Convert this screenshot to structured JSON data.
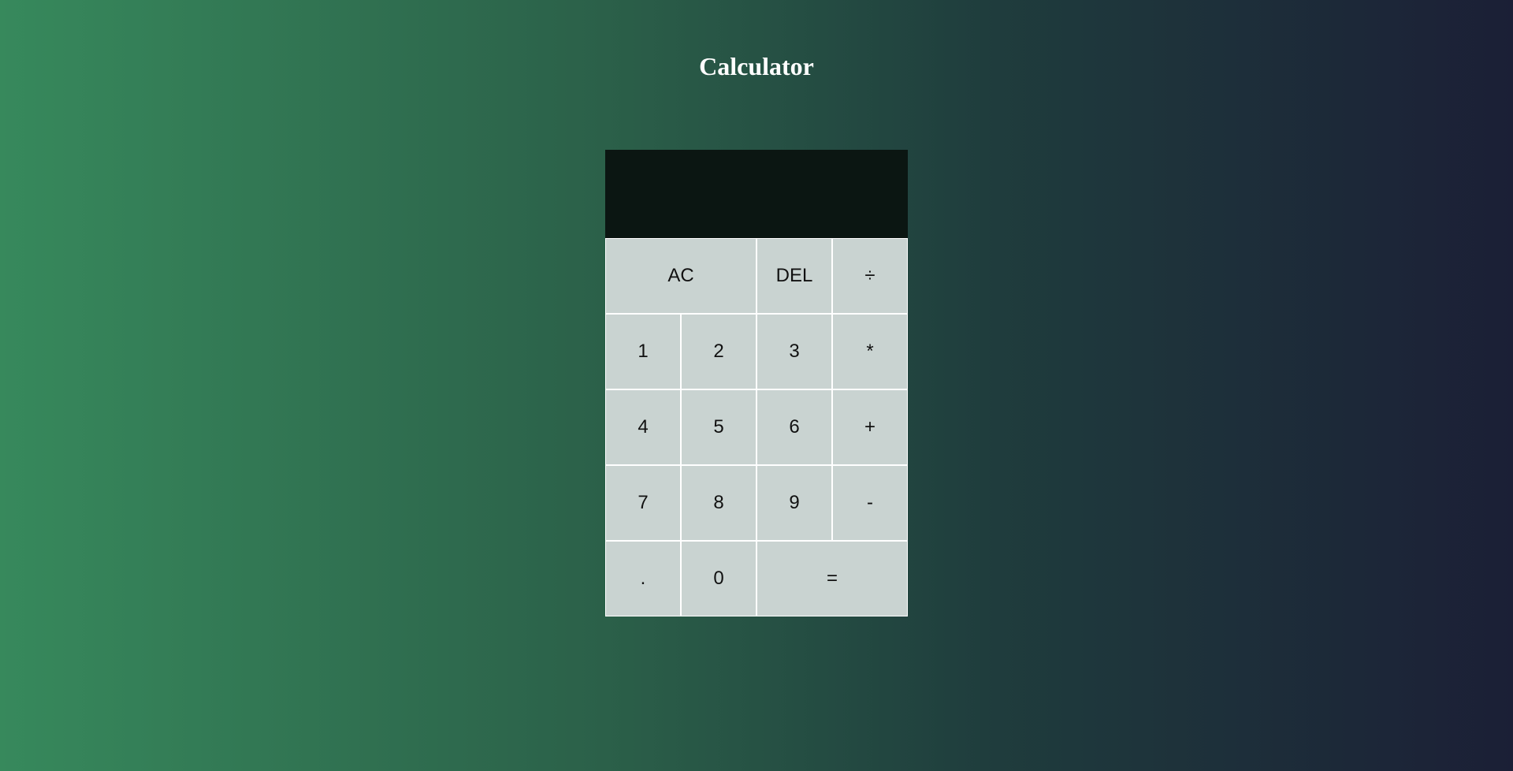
{
  "page": {
    "title": "Calculator"
  },
  "display": {
    "previous_operand": "",
    "current_operand": ""
  },
  "keys": {
    "clear": "AC",
    "delete": "DEL",
    "divide": "÷",
    "one": "1",
    "two": "2",
    "three": "3",
    "multiply": "*",
    "four": "4",
    "five": "5",
    "six": "6",
    "add": "+",
    "seven": "7",
    "eight": "8",
    "nine": "9",
    "subtract": "-",
    "decimal": ".",
    "zero": "0",
    "equals": "="
  },
  "colors": {
    "gradient_start": "#37895c",
    "gradient_end": "#1b1f36",
    "display_background": "#0b1612",
    "key_background": "#c9d3d1",
    "key_border": "#ffffff"
  }
}
